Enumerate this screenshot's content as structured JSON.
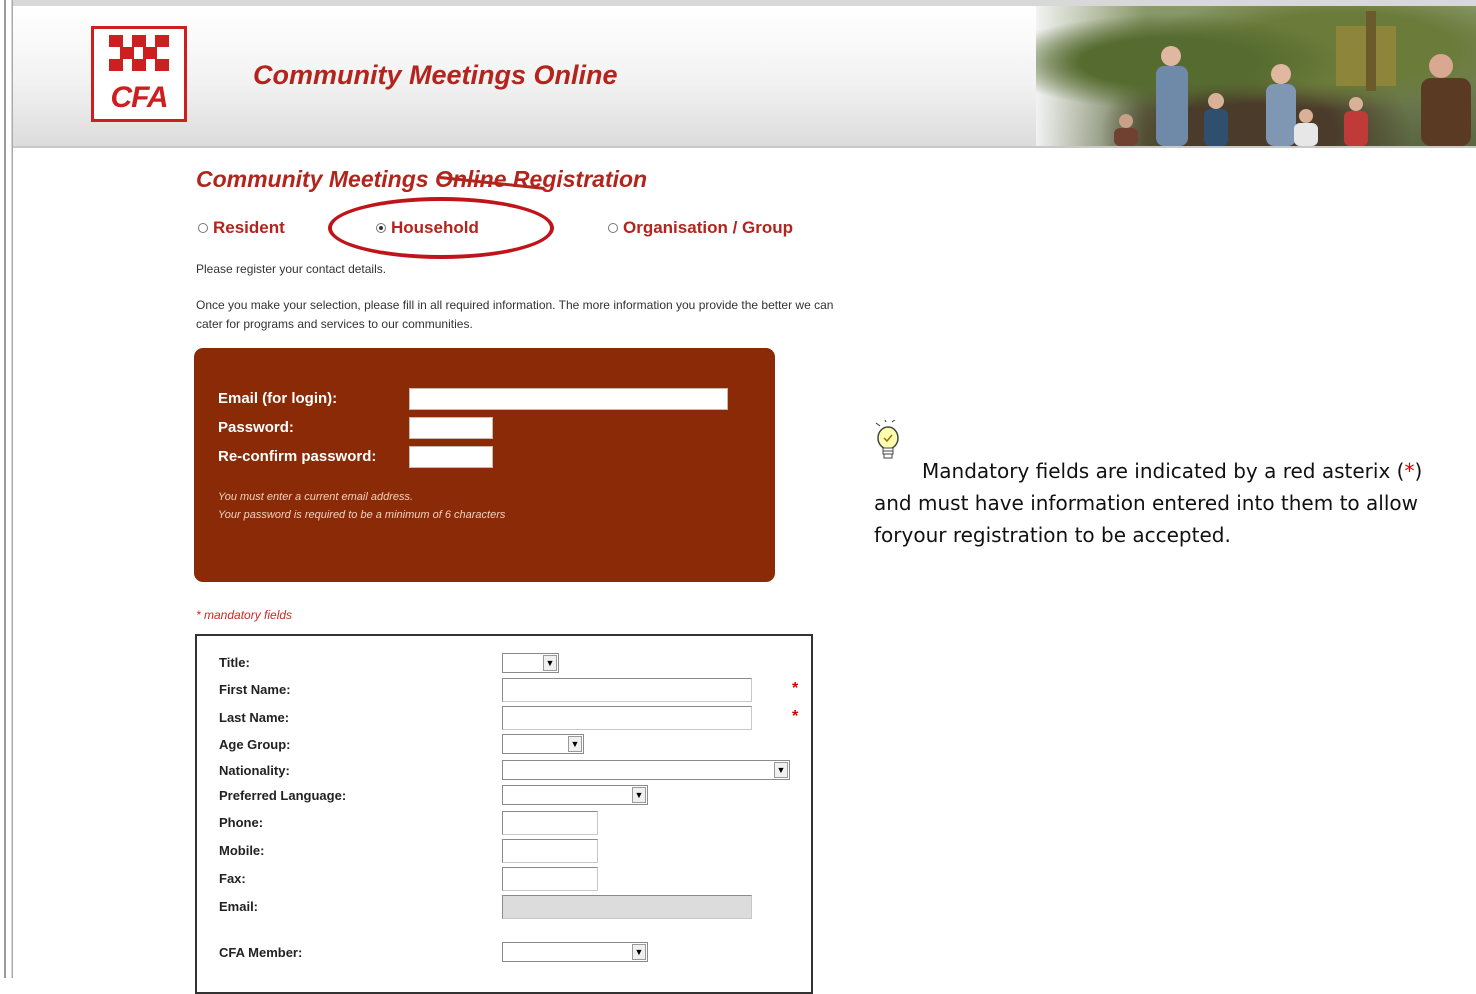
{
  "header": {
    "logo_text": "CFA",
    "site_title": "Community Meetings Online"
  },
  "registration": {
    "title": "Community Meetings Online Registration",
    "options": [
      {
        "label": "Resident",
        "checked": false
      },
      {
        "label": "Household",
        "checked": true
      },
      {
        "label": "Organisation / Group",
        "checked": false
      }
    ],
    "intro1": "Please register your contact details.",
    "intro2": "Once you make your selection, please fill in all required information. The more information you provide the better we can",
    "intro3": "cater for programs and services to our communities."
  },
  "login": {
    "email_label": "Email (for login):",
    "password_label": "Password:",
    "reconfirm_label": "Re-confirm password:",
    "note1": "You must enter a current email address.",
    "note2": "Your password is required to be a minimum of 6 characters"
  },
  "form": {
    "mandatory_note": "* mandatory fields",
    "asterisk": "*",
    "select_arrow": "▼",
    "fields": {
      "title": "Title:",
      "first_name": "First Name:",
      "last_name": "Last Name:",
      "age_group": "Age Group:",
      "nationality": "Nationality:",
      "preferred_language": "Preferred Language:",
      "phone": "Phone:",
      "mobile": "Mobile:",
      "fax": "Fax:",
      "email": "Email:",
      "cfa_member": "CFA Member:"
    }
  },
  "tip": {
    "part1": "Mandatory fields are indicated by a red asterix (",
    "star": "*",
    "part2": ") and must have information entered into them to allow foryour registration to be accepted."
  },
  "colors": {
    "brand_red": "#b3241c",
    "login_box": "#8b2a06",
    "highlight_ellipse": "#c0141b"
  }
}
